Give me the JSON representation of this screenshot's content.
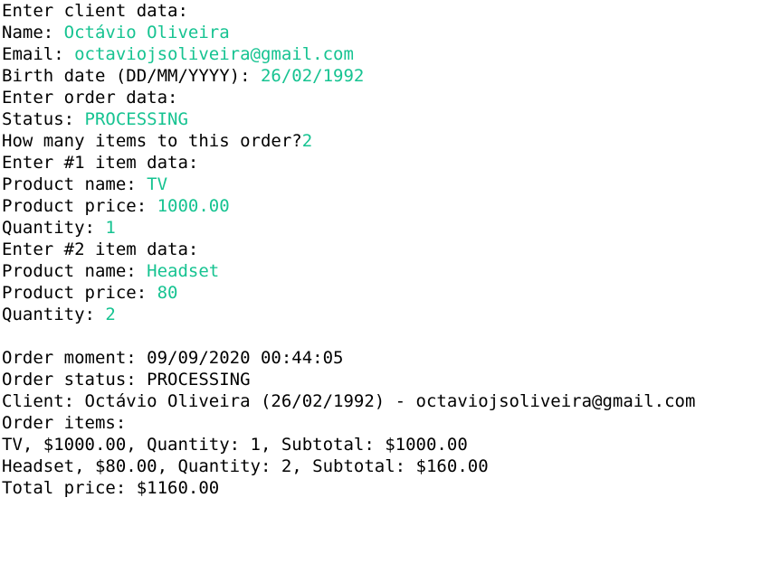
{
  "colors": {
    "background": "#ffffff",
    "output_text": "#000000",
    "input_text": "#16c391"
  },
  "input_section": {
    "client_header": "Enter client data:",
    "name_prompt": "Name: ",
    "name_value": "Octávio Oliveira",
    "email_prompt": "Email: ",
    "email_value": "octaviojsoliveira@gmail.com",
    "birth_prompt": "Birth date (DD/MM/YYYY): ",
    "birth_value": "26/02/1992",
    "order_header": "Enter order data:",
    "status_prompt": "Status: ",
    "status_value": "PROCESSING",
    "items_prompt": "How many items to this order?",
    "items_value": "2",
    "items": [
      {
        "header": "Enter #1 item data:",
        "name_prompt": "Product name: ",
        "name_value": "TV",
        "price_prompt": "Product price: ",
        "price_value": "1000.00",
        "qty_prompt": "Quantity: ",
        "qty_value": "1"
      },
      {
        "header": "Enter #2 item data:",
        "name_prompt": "Product name: ",
        "name_value": "Headset",
        "price_prompt": "Product price: ",
        "price_value": "80",
        "qty_prompt": "Quantity: ",
        "qty_value": "2"
      }
    ]
  },
  "summary_section": {
    "moment": "Order moment: 09/09/2020 00:44:05",
    "status": "Order status: PROCESSING",
    "client": "Client: Octávio Oliveira (26/02/1992) - octaviojsoliveira@gmail.com",
    "items_header": "Order items:",
    "item_lines": [
      "TV, $1000.00, Quantity: 1, Subtotal: $1000.00",
      "Headset, $80.00, Quantity: 2, Subtotal: $160.00"
    ],
    "total": "Total price: $1160.00"
  }
}
